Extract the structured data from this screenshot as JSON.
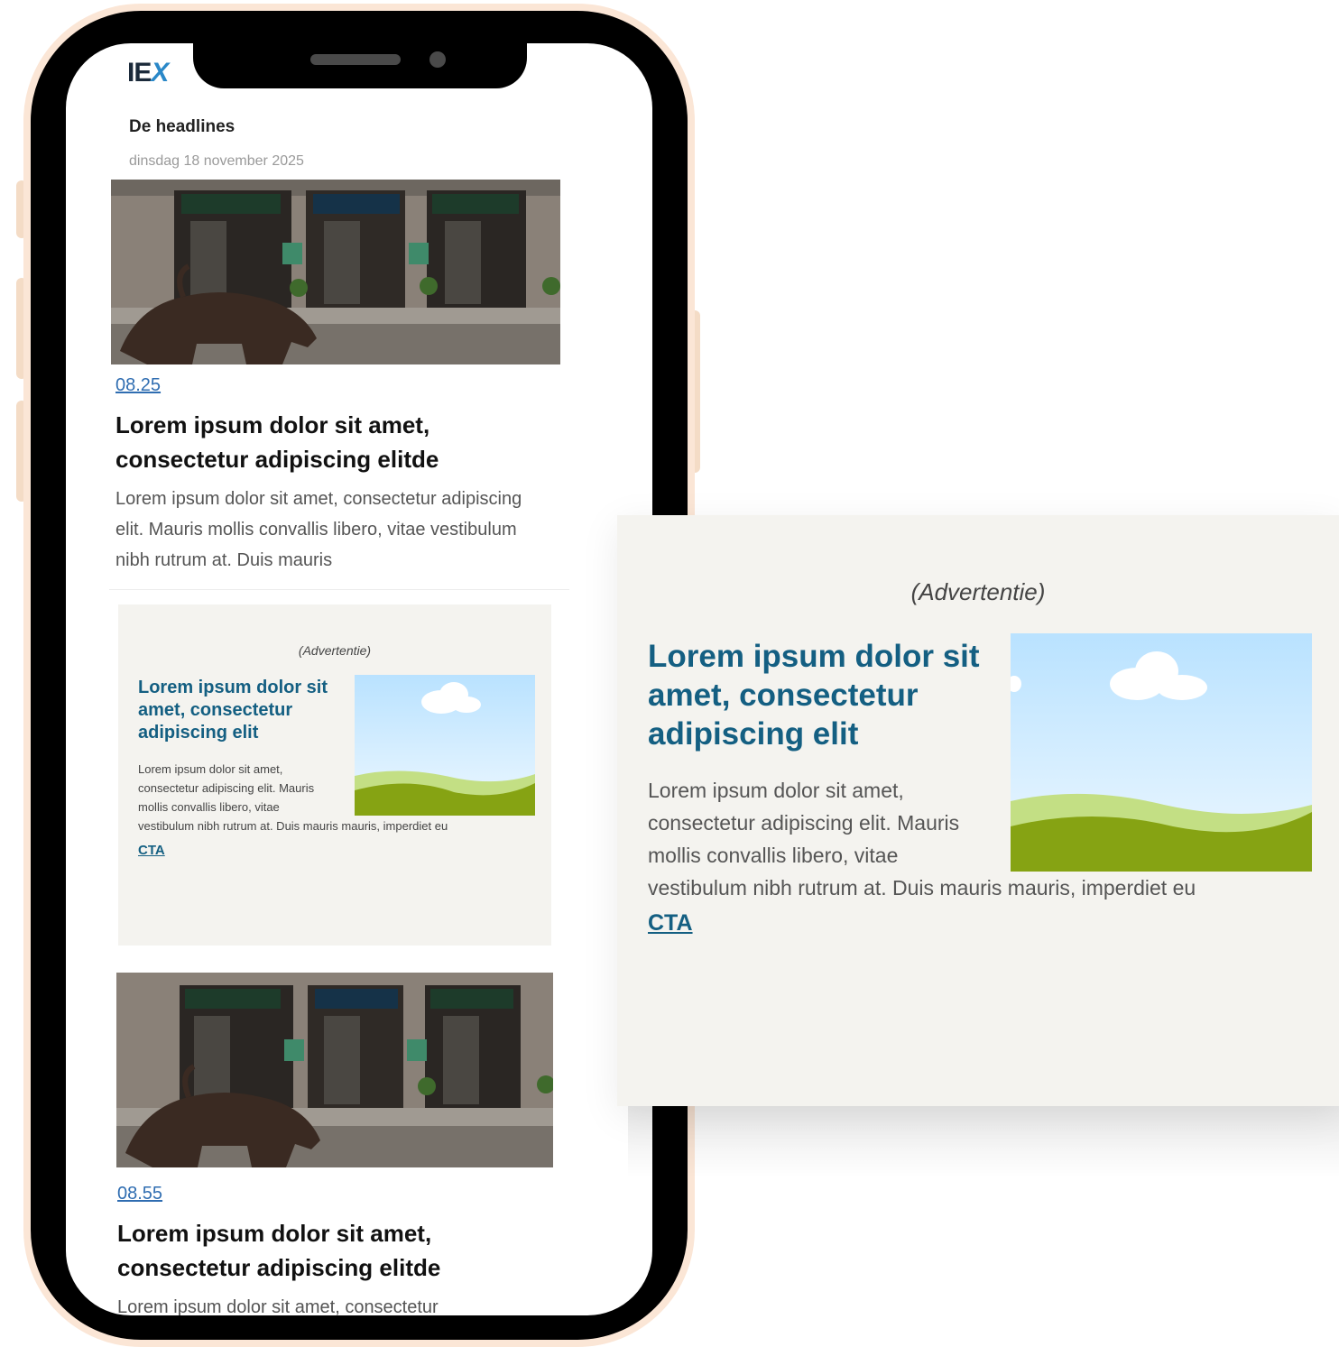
{
  "colors": {
    "accent": "#145f82",
    "link": "#2f6db1",
    "ad_background": "#f4f3ef",
    "phone_bezel": "#fbe6d6"
  },
  "app": {
    "logo_text": "IE",
    "logo_accent": "X",
    "section_title": "De headlines",
    "date": "dinsdag 18 november 2025"
  },
  "articles": [
    {
      "time": "08.25",
      "title": "Lorem ipsum dolor sit amet, consectetur adipiscing elitde",
      "excerpt": "Lorem ipsum dolor sit amet, consectetur adipiscing elit. Mauris mollis convallis libero, vitae vestibulum nibh rutrum at. Duis mauris"
    },
    {
      "time": "08.55",
      "title": "Lorem ipsum dolor sit amet, consectetur adipiscing elitde",
      "excerpt": "Lorem ipsum dolor sit amet, consectetur"
    }
  ],
  "ad": {
    "label": "(Advertentie)",
    "title": "Lorem ipsum dolor sit amet, consectetur adipiscing elit",
    "body": "Lorem ipsum dolor sit amet, consectetur adipiscing elit. Mauris mollis convallis libero, vitae vestibulum nibh rutrum at. Duis mauris mauris, imperdiet eu",
    "body_lines": [
      "Lorem ipsum dolor sit amet,",
      "consectetur adipiscing elit. Mauris",
      "mollis convallis libero, vitae",
      "vestibulum nibh rutrum at. Duis mauris mauris, imperdiet eu"
    ],
    "cta": "CTA"
  }
}
